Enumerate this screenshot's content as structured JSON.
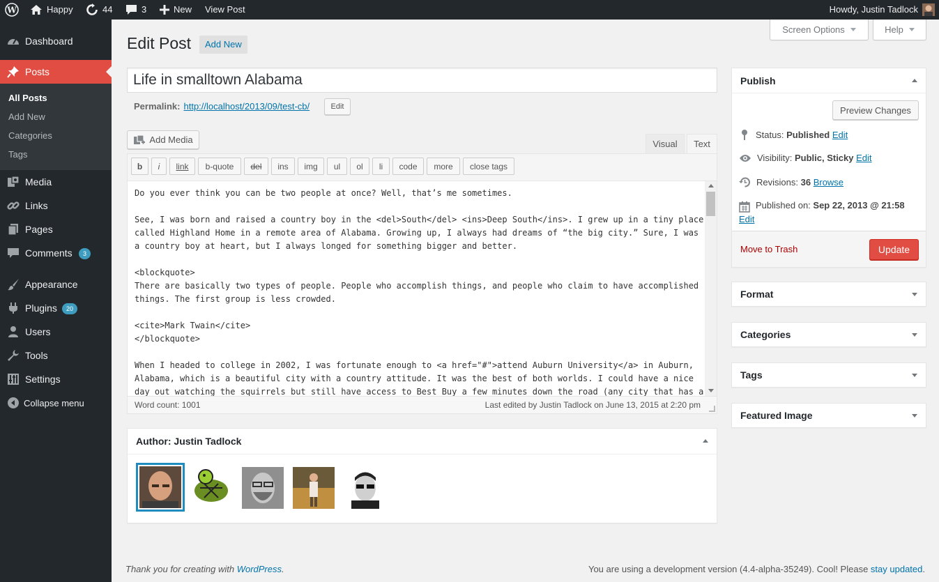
{
  "adminbar": {
    "site_name": "Happy",
    "updates_count": "44",
    "comments_count": "3",
    "new_label": "New",
    "view_post_label": "View Post",
    "howdy": "Howdy, Justin Tadlock"
  },
  "sidebar": {
    "dashboard": "Dashboard",
    "posts": "Posts",
    "sub": {
      "all_posts": "All Posts",
      "add_new": "Add New",
      "categories": "Categories",
      "tags": "Tags"
    },
    "media": "Media",
    "links": "Links",
    "pages": "Pages",
    "comments": "Comments",
    "comments_badge": "3",
    "appearance": "Appearance",
    "plugins": "Plugins",
    "plugins_badge": "20",
    "users": "Users",
    "tools": "Tools",
    "settings": "Settings",
    "collapse": "Collapse menu"
  },
  "screen_meta": {
    "screen_options": "Screen Options",
    "help": "Help"
  },
  "page": {
    "title": "Edit Post",
    "add_new": "Add New"
  },
  "post": {
    "title_value": "Life in smalltown Alabama",
    "permalink_label": "Permalink:",
    "permalink_url": "http://localhost/2013/09/test-cb/",
    "permalink_edit": "Edit"
  },
  "editor": {
    "add_media": "Add Media",
    "tab_visual": "Visual",
    "tab_text": "Text",
    "quicktags": [
      "b",
      "i",
      "link",
      "b-quote",
      "del",
      "ins",
      "img",
      "ul",
      "ol",
      "li",
      "code",
      "more",
      "close tags"
    ],
    "content_lines": [
      "Do you ever think you can be two people at once? Well, that’s me sometimes.",
      "",
      "See, I was born and raised a country boy in the <del>South</del> <ins>Deep South</ins>. I grew up in a tiny place",
      "called Highland Home in a remote area of Alabama. Growing up, I always had dreams of “the big city.” Sure, I was",
      "a country boy at heart, but I always longed for something bigger and better.",
      "",
      "<blockquote>",
      "There are basically two types of people. People who accomplish things, and people who claim to have accomplished",
      "things. The first group is less crowded.",
      "",
      "<cite>Mark Twain</cite>",
      "</blockquote>",
      "",
      "When I headed to college in 2002, I was fortunate enough to <a href=\"#\">attend Auburn University</a> in Auburn,",
      "Alabama, which is a beautiful city with a country attitude. It was the best of both worlds. I could have a nice",
      "day out watching the squirrels but still have access to Best Buy a few minutes down the road (any city that has a"
    ],
    "word_count": "Word count: 1001",
    "last_edited": "Last edited by Justin Tadlock on June 13, 2015 at 2:20 pm"
  },
  "author_box": {
    "title": "Author: Justin Tadlock"
  },
  "publish": {
    "title": "Publish",
    "preview": "Preview Changes",
    "status_label": "Status:",
    "status_value": "Published",
    "visibility_label": "Visibility:",
    "visibility_value": "Public, Sticky",
    "revisions_label": "Revisions:",
    "revisions_value": "36",
    "browse": "Browse",
    "published_label": "Published on:",
    "published_value": "Sep 22, 2013 @ 21:58",
    "edit": "Edit",
    "trash": "Move to Trash",
    "update": "Update"
  },
  "boxes": {
    "format": "Format",
    "categories": "Categories",
    "tags": "Tags",
    "featured_image": "Featured Image"
  },
  "footer": {
    "thanks_prefix": "Thank you for creating with ",
    "wordpress": "WordPress",
    "thanks_suffix": ".",
    "version_text": "You are using a development version (4.4-alpha-35249). Cool! Please ",
    "stay_updated": "stay updated",
    "version_suffix": "."
  },
  "colors": {
    "adminbar_bg": "#23282d",
    "active_menu": "#e14d43",
    "link": "#0073aa",
    "update_button": "#e14d43"
  }
}
